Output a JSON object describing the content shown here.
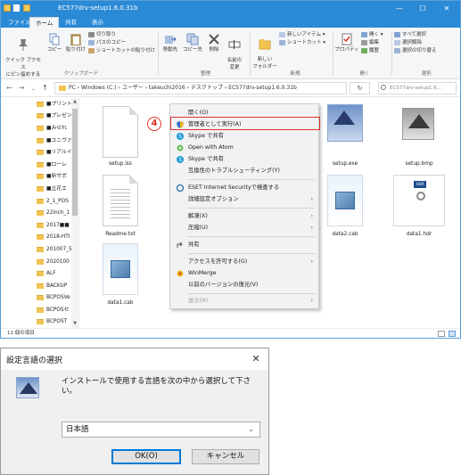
{
  "explorer": {
    "title": "EC577drv-setup1.6.0.31b",
    "window_controls": {
      "minimize": "—",
      "maximize": "☐",
      "close": "✕"
    },
    "tabs": [
      "ファイル",
      "ホーム",
      "共有",
      "表示"
    ],
    "ribbon": {
      "clipboard": {
        "pin": "クイック アクセス\nにピン留めする",
        "copy": "コピー",
        "paste": "貼り付け",
        "cut": "切り取り",
        "copy_path": "パスのコピー",
        "paste_shortcut": "ショートカットの貼り付け",
        "group": "クリップボード"
      },
      "organize": {
        "move_to": "移動先",
        "copy_to": "コピー先",
        "delete": "削除",
        "rename": "名前の\n変更",
        "group": "整理"
      },
      "new": {
        "new_folder": "新しい\nフォルダー",
        "new_item": "新しいアイテム ▾",
        "shortcut": "ショートカット ▾",
        "group": "新規"
      },
      "open": {
        "properties": "プロパティ",
        "open": "開く ▾",
        "edit": "編集",
        "history": "履歴",
        "group": "開く"
      },
      "select": {
        "select_all": "すべて選択",
        "select_none": "選択解除",
        "invert": "選択の切り替え",
        "group": "選択"
      }
    },
    "address_bar": {
      "path": "PC  ›  Windows (C:)  ›  ユーザー  ›  takeuchi2016  ›  デスクトップ  ›  EC577drv-setup1.6.0.31b",
      "search_placeholder": "EC577drv-setup1.6..."
    },
    "nav_items": [
      "■プリント",
      "■プレゼン",
      "■みせれ",
      "■ユニヴァ",
      "■リアルイ",
      "■ローレ",
      "■新サポ",
      "■立花エ",
      "2_1_POS",
      "22inch_1",
      "2017■■",
      "2018-HTI",
      "201007_5",
      "2020100",
      "ALF",
      "BACKUP",
      "BCPOSVe",
      "BCPOSセ",
      "BCPOST"
    ],
    "files": [
      {
        "name": "setup.iss",
        "type": "doc"
      },
      {
        "name": "setup.exe",
        "type": "exe"
      },
      {
        "name": "setup.bmp",
        "type": "bmp"
      },
      {
        "name": "Readme.txt",
        "type": "doc"
      },
      {
        "name": "data2.cab",
        "type": "cab"
      },
      {
        "name": "data1.hdr",
        "type": "hdr"
      },
      {
        "name": "data1.cab",
        "type": "cab"
      }
    ],
    "status": "11 個の項目"
  },
  "context_menu": {
    "step_marker": "4",
    "items": [
      {
        "label": "開く(O)",
        "icon": "",
        "submenu": false,
        "disabled": false
      },
      {
        "label": "管理者として実行(A)",
        "icon": "shield-icon",
        "submenu": false,
        "disabled": false
      },
      {
        "label": "Skype で共有",
        "icon": "skype-icon",
        "submenu": false,
        "disabled": false
      },
      {
        "label": "Open with Atom",
        "icon": "atom-icon",
        "submenu": false,
        "disabled": false
      },
      {
        "label": "Skype で共有",
        "icon": "skype-icon",
        "submenu": false,
        "disabled": false
      },
      {
        "label": "互換性のトラブルシューティング(Y)",
        "icon": "",
        "submenu": false,
        "disabled": false
      },
      {
        "label": "ESET Internet Securityで検査する",
        "icon": "eset-icon",
        "submenu": false,
        "disabled": false
      },
      {
        "label": "詳細設定オプション",
        "icon": "",
        "submenu": true,
        "disabled": false
      },
      {
        "label": "解凍(X)",
        "icon": "",
        "submenu": true,
        "disabled": false
      },
      {
        "label": "圧縮(U)",
        "icon": "",
        "submenu": true,
        "disabled": false
      },
      {
        "label": "共有",
        "icon": "share-icon",
        "submenu": false,
        "disabled": false
      },
      {
        "label": "アクセスを許可する(G)",
        "icon": "",
        "submenu": true,
        "disabled": false
      },
      {
        "label": "WinMerge",
        "icon": "winmerge-icon",
        "submenu": false,
        "disabled": false
      },
      {
        "label": "以前のバージョンの復元(V)",
        "icon": "",
        "submenu": false,
        "disabled": false
      },
      {
        "label": "送る(N)",
        "icon": "",
        "submenu": true,
        "disabled": true
      }
    ],
    "submenu_arrow": "›"
  },
  "dialog": {
    "title": "設定言語の選択",
    "close": "✕",
    "message": "インストールで使用する言語を次の中から選択して下さい。",
    "selected_language": "日本語",
    "chevron": "⌄",
    "ok_label": "OK(O)",
    "cancel_label": "キャンセル"
  },
  "colors": {
    "accent": "#2b8ad6",
    "highlight_box": "#d9342b",
    "folder": "#f3c350",
    "default_button_border": "#0078d7"
  }
}
